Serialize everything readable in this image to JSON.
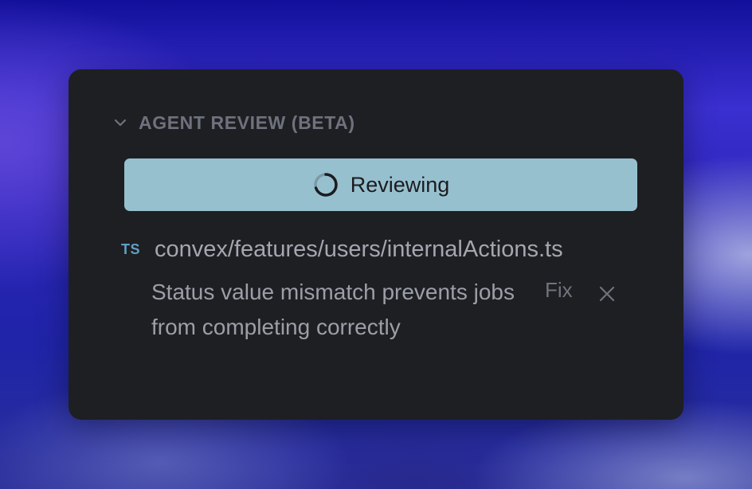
{
  "panel": {
    "section_title": "AGENT REVIEW (BETA)",
    "status_button_label": "Reviewing",
    "file": {
      "icon_label": "TS",
      "path": "convex/features/users/internalActions.ts"
    },
    "issue": {
      "message": "Status value mismatch prevents jobs from completing correctly",
      "fix_label": "Fix"
    }
  },
  "icons": {
    "collapse": "chevron-down-icon",
    "loading": "spinner-icon",
    "file_type": "typescript-file-icon",
    "dismiss": "close-icon"
  },
  "colors": {
    "panel_background": "#1e1f23",
    "button_background": "#97c0cf",
    "muted_text": "#6e727d",
    "file_text": "#a3a7b0",
    "ts_accent": "#5fa0c4"
  }
}
